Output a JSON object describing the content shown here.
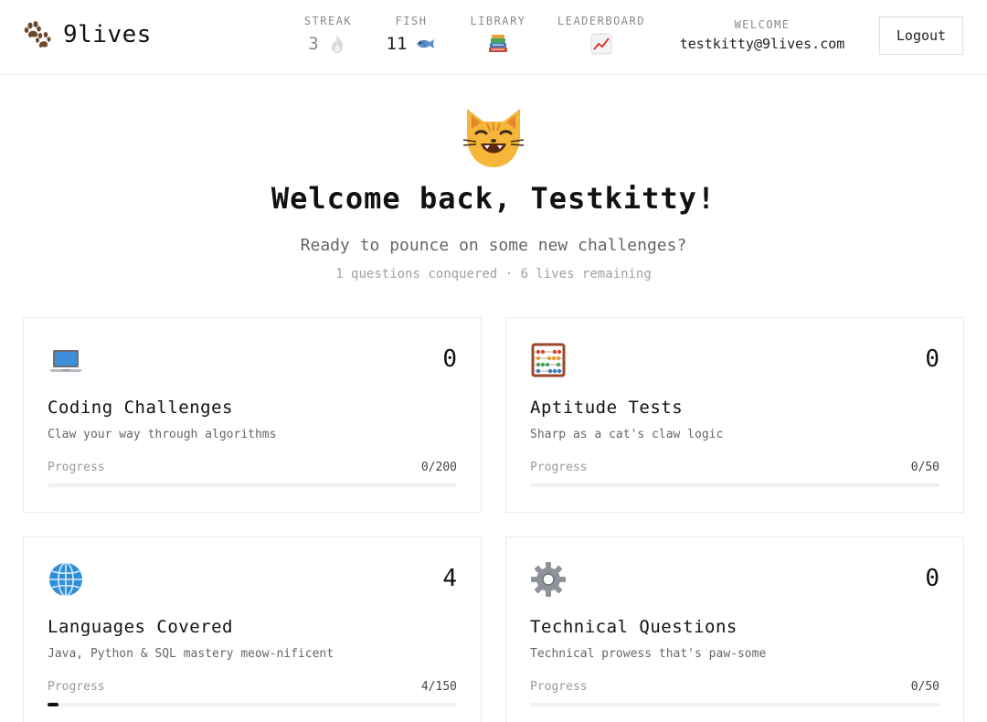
{
  "brand": {
    "name": "9lives",
    "icon": "paw-prints-icon"
  },
  "header": {
    "stats": {
      "streak": {
        "label": "STREAK",
        "value": "3",
        "icon": "fire-icon"
      },
      "fish": {
        "label": "FISH",
        "value": "11",
        "icon": "fish-icon"
      },
      "library": {
        "label": "LIBRARY",
        "icon": "books-icon"
      },
      "leaderboard": {
        "label": "LEADERBOARD",
        "icon": "chart-increasing-icon"
      }
    },
    "welcome": {
      "label": "WELCOME",
      "email": "testkitty@9lives.com"
    },
    "logout_label": "Logout"
  },
  "hero": {
    "icon": "cat-face-icon",
    "title": "Welcome back, Testkitty!",
    "subtitle": "Ready to pounce on some new challenges?",
    "meta": "1 questions conquered · 6 lives remaining"
  },
  "cards": [
    {
      "icon": "laptop-icon",
      "count": "0",
      "title": "Coding Challenges",
      "description": "Claw your way through algorithms",
      "progress_label": "Progress",
      "progress_text": "0/200",
      "progress": 0.0
    },
    {
      "icon": "abacus-icon",
      "count": "0",
      "title": "Aptitude Tests",
      "description": "Sharp as a cat's claw logic",
      "progress_label": "Progress",
      "progress_text": "0/50",
      "progress": 0.0
    },
    {
      "icon": "globe-icon",
      "count": "4",
      "title": "Languages Covered",
      "description": "Java, Python & SQL mastery meow-nificent",
      "progress_label": "Progress",
      "progress_text": "4/150",
      "progress": 0.0267
    },
    {
      "icon": "gear-icon",
      "count": "0",
      "title": "Technical Questions",
      "description": "Technical prowess that's paw-some",
      "progress_label": "Progress",
      "progress_text": "0/50",
      "progress": 0.0
    }
  ],
  "colors": {
    "accent": "#111111",
    "muted": "#8a8a8a",
    "border": "#ececec"
  }
}
